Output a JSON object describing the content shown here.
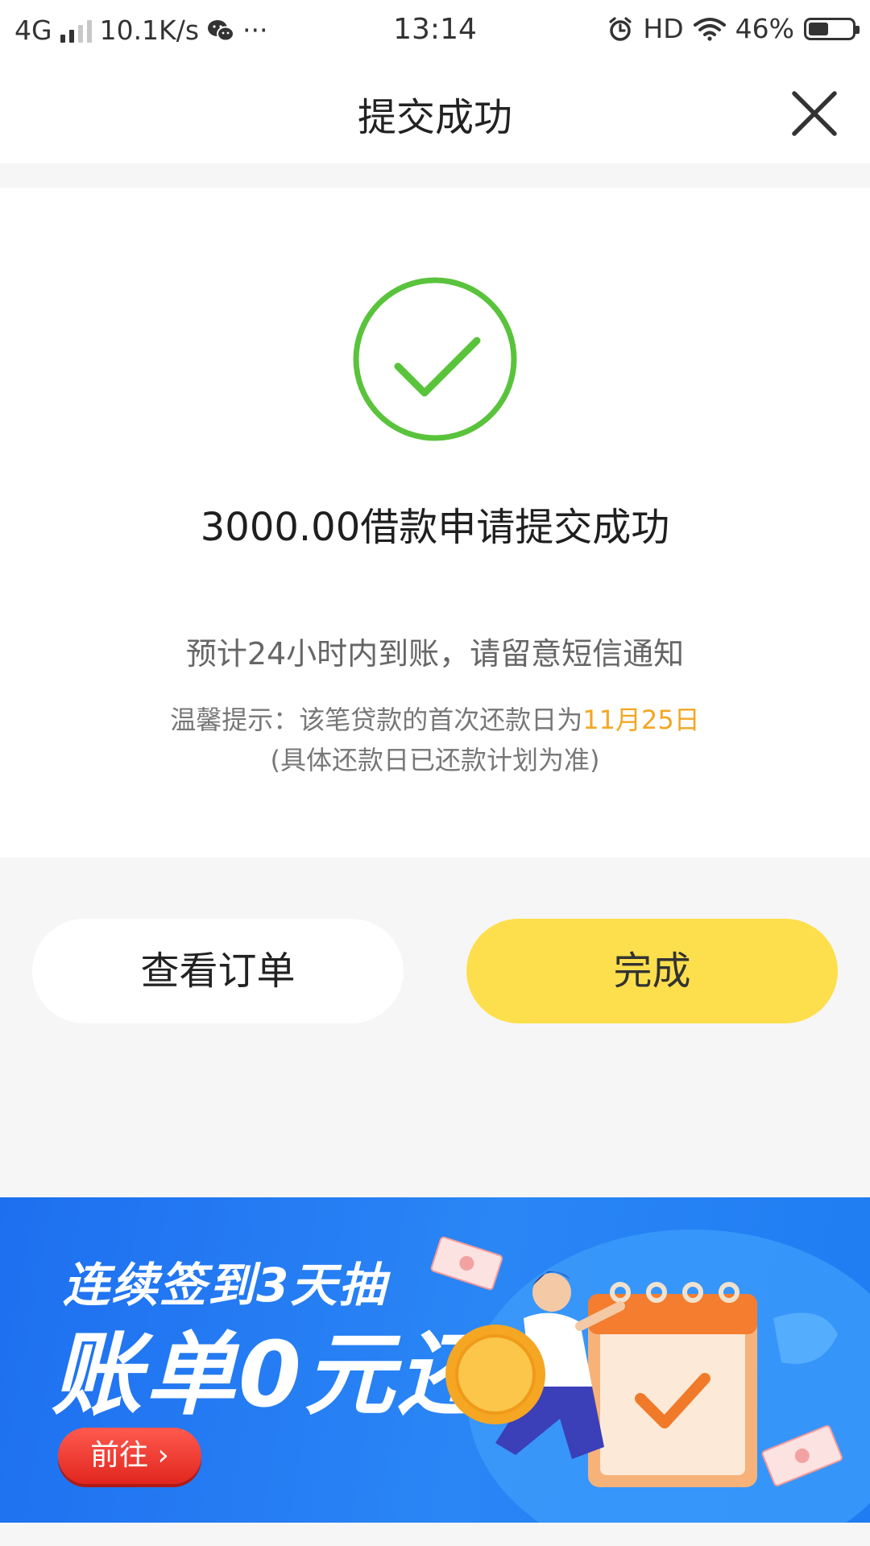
{
  "status_bar": {
    "network": "4G",
    "speed": "10.1K/s",
    "more": "···",
    "time": "13:14",
    "hd": "HD",
    "battery_percent": "46%",
    "battery_level": 0.46
  },
  "nav": {
    "title": "提交成功"
  },
  "result": {
    "headline": "3000.00借款申请提交成功",
    "eta": "预计24小时内到账，请留意短信通知",
    "tip_prefix": "温馨提示：该笔贷款的首次还款日为",
    "tip_date": "11月25日",
    "tip_note": "(具体还款日已还款计划为准)"
  },
  "buttons": {
    "view_order": "查看订单",
    "done": "完成"
  },
  "banner": {
    "line1": "连续签到3天抽",
    "line2": "账单0元还",
    "cta": "前往 ›"
  },
  "colors": {
    "success_green": "#5ac33c",
    "primary_yellow": "#fddf4d",
    "highlight_orange": "#f5a623",
    "banner_blue": "#1e6ff0",
    "cta_red": "#e0261e"
  }
}
